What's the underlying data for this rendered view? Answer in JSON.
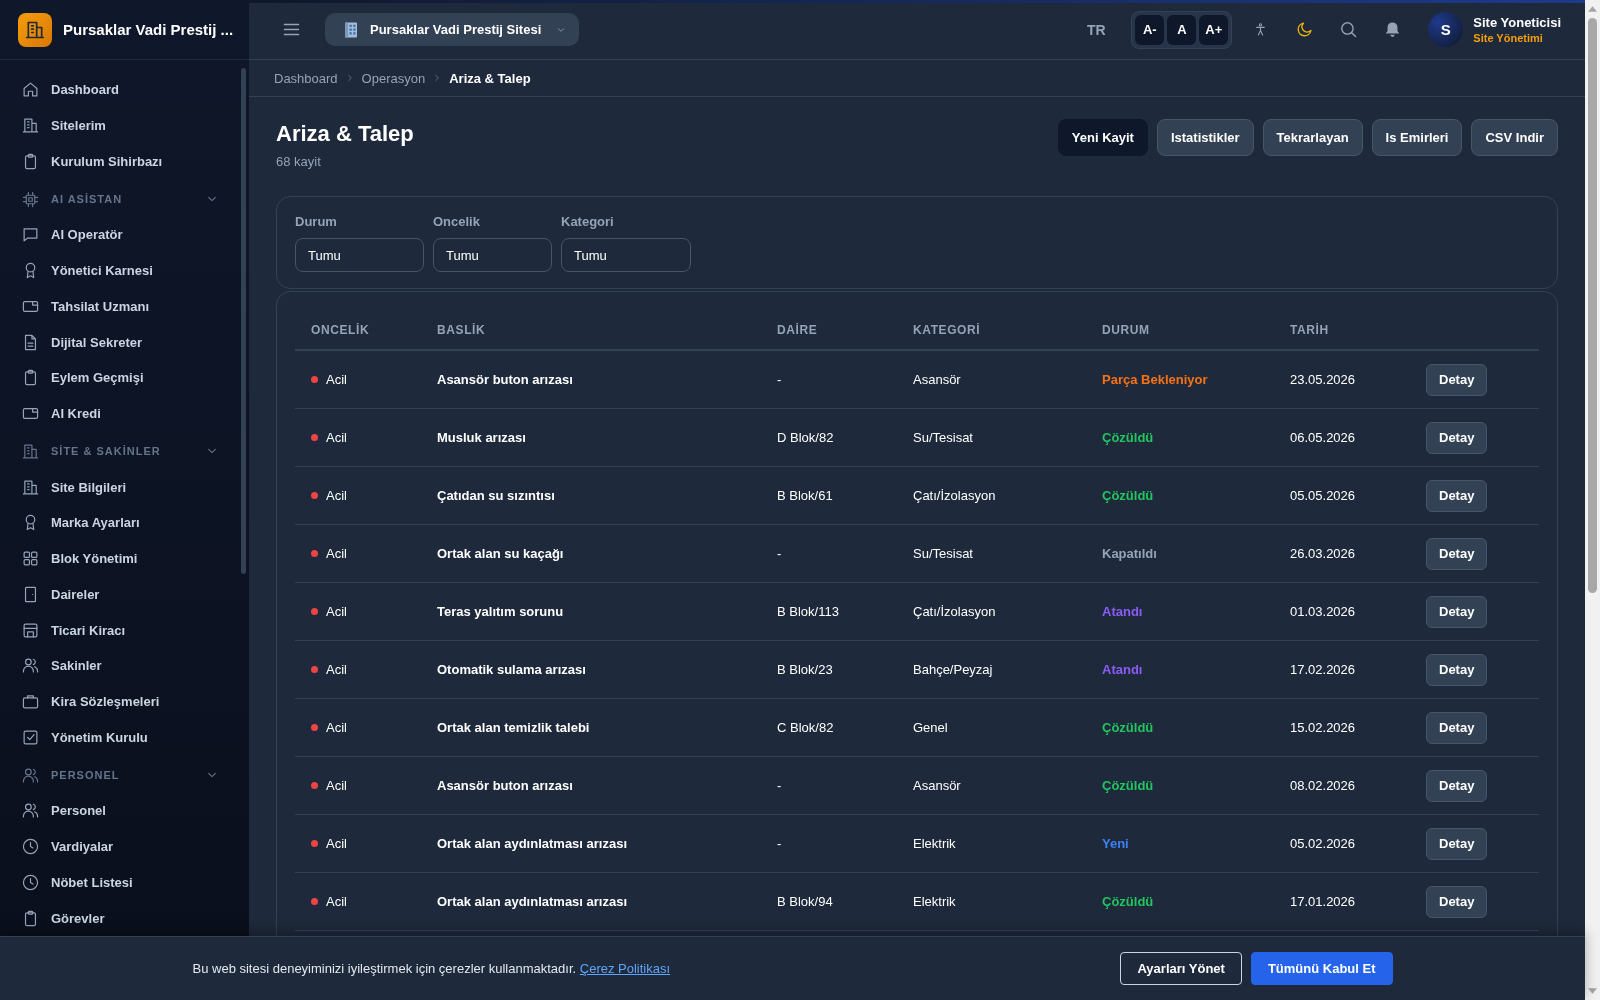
{
  "sidebar": {
    "brand": "Pursaklar Vadi Prestij ...",
    "items": [
      {
        "kind": "link",
        "label": "Dashboard",
        "selected": false
      },
      {
        "kind": "link",
        "label": "Sitelerim",
        "selected": false
      },
      {
        "kind": "link",
        "label": "Kurulum Sihirbazı",
        "selected": false
      },
      {
        "kind": "section",
        "label": "AI ASİSTAN",
        "expanded": true,
        "children": [
          {
            "label": "AI Operatör",
            "selected": false
          },
          {
            "label": "Yönetici Karnesi",
            "selected": false
          },
          {
            "label": "Tahsilat Uzmanı",
            "selected": false
          },
          {
            "label": "Dijital Sekreter",
            "selected": false
          },
          {
            "label": "Eylem Geçmişi",
            "selected": false
          },
          {
            "label": "AI Kredi",
            "selected": false
          }
        ]
      },
      {
        "kind": "section",
        "label": "SİTE & SAKİNLER",
        "expanded": true,
        "children": [
          {
            "label": "Site Bilgileri",
            "selected": false
          },
          {
            "label": "Marka Ayarları",
            "selected": false
          },
          {
            "label": "Blok Yönetimi",
            "selected": false
          },
          {
            "label": "Daireler",
            "selected": false
          },
          {
            "label": "Ticari Kiracı",
            "selected": false
          },
          {
            "label": "Sakinler",
            "selected": false
          },
          {
            "label": "Kira Sözleşmeleri",
            "selected": false
          },
          {
            "label": "Yönetim Kurulu",
            "selected": false
          }
        ]
      },
      {
        "kind": "section",
        "label": "PERSONEL",
        "expanded": true,
        "children": [
          {
            "label": "Personel",
            "selected": false
          },
          {
            "label": "Vardiyalar",
            "selected": false
          },
          {
            "label": "Nöbet Listesi",
            "selected": false
          },
          {
            "label": "Görevler",
            "selected": false
          }
        ]
      }
    ]
  },
  "header": {
    "site_selector": "Pursaklar Vadi Prestij Sitesi",
    "language": "TR",
    "font_size_buttons": [
      "A-",
      "A",
      "A+"
    ],
    "user": {
      "initial": "S",
      "name": "Site Yoneticisi",
      "role": "Site Yönetimi"
    }
  },
  "breadcrumb": [
    "Dashboard",
    "Operasyon",
    "Ariza & Talep"
  ],
  "page": {
    "title": "Ariza & Talep",
    "count": "68 kayit",
    "actions": [
      {
        "label": "Yeni Kayit",
        "kind": "primary"
      },
      {
        "label": "Istatistikler",
        "kind": "secondary"
      },
      {
        "label": "Tekrarlayan",
        "kind": "secondary"
      },
      {
        "label": "Is Emirleri",
        "kind": "secondary"
      },
      {
        "label": "CSV Indir",
        "kind": "secondary"
      }
    ]
  },
  "filters": [
    {
      "label": "Durum",
      "value": "Tumu"
    },
    {
      "label": "Oncelik",
      "value": "Tumu"
    },
    {
      "label": "Kategori",
      "value": "Tumu"
    }
  ],
  "table": {
    "columns": [
      "ONCELİK",
      "BASLİK",
      "DAİRE",
      "KATEGORİ",
      "DURUM",
      "TARİH"
    ],
    "rows": [
      {
        "priority": {
          "text": "Acil",
          "color": "#ef4444"
        },
        "title": "Asansör buton arızası",
        "unit": "-",
        "category": "Asansör",
        "status": {
          "text": "Parça Bekleniyor",
          "color": "#f97316"
        },
        "date": "23.05.2026",
        "action": "Detay"
      },
      {
        "priority": {
          "text": "Acil",
          "color": "#ef4444"
        },
        "title": "Musluk arızası",
        "unit": "D Blok/82",
        "category": "Su/Tesisat",
        "status": {
          "text": "Çözüldü",
          "color": "#22c55e"
        },
        "date": "06.05.2026",
        "action": "Detay"
      },
      {
        "priority": {
          "text": "Acil",
          "color": "#ef4444"
        },
        "title": "Çatıdan su sızıntısı",
        "unit": "B Blok/61",
        "category": "Çatı/İzolasyon",
        "status": {
          "text": "Çözüldü",
          "color": "#22c55e"
        },
        "date": "05.05.2026",
        "action": "Detay"
      },
      {
        "priority": {
          "text": "Acil",
          "color": "#ef4444"
        },
        "title": "Ortak alan su kaçağı",
        "unit": "-",
        "category": "Su/Tesisat",
        "status": {
          "text": "Kapatıldı",
          "color": "#94a3b8"
        },
        "date": "26.03.2026",
        "action": "Detay"
      },
      {
        "priority": {
          "text": "Acil",
          "color": "#ef4444"
        },
        "title": "Teras yalıtım sorunu",
        "unit": "B Blok/113",
        "category": "Çatı/İzolasyon",
        "status": {
          "text": "Atandı",
          "color": "#8b5cf6"
        },
        "date": "01.03.2026",
        "action": "Detay"
      },
      {
        "priority": {
          "text": "Acil",
          "color": "#ef4444"
        },
        "title": "Otomatik sulama arızası",
        "unit": "B Blok/23",
        "category": "Bahçe/Peyzaj",
        "status": {
          "text": "Atandı",
          "color": "#8b5cf6"
        },
        "date": "17.02.2026",
        "action": "Detay"
      },
      {
        "priority": {
          "text": "Acil",
          "color": "#ef4444"
        },
        "title": "Ortak alan temizlik talebi",
        "unit": "C Blok/82",
        "category": "Genel",
        "status": {
          "text": "Çözüldü",
          "color": "#22c55e"
        },
        "date": "15.02.2026",
        "action": "Detay"
      },
      {
        "priority": {
          "text": "Acil",
          "color": "#ef4444"
        },
        "title": "Asansör buton arızası",
        "unit": "-",
        "category": "Asansör",
        "status": {
          "text": "Çözüldü",
          "color": "#22c55e"
        },
        "date": "08.02.2026",
        "action": "Detay"
      },
      {
        "priority": {
          "text": "Acil",
          "color": "#ef4444"
        },
        "title": "Ortak alan aydınlatması arızası",
        "unit": "-",
        "category": "Elektrik",
        "status": {
          "text": "Yeni",
          "color": "#3b82f6"
        },
        "date": "05.02.2026",
        "action": "Detay"
      },
      {
        "priority": {
          "text": "Acil",
          "color": "#ef4444"
        },
        "title": "Ortak alan aydınlatması arızası",
        "unit": "B Blok/94",
        "category": "Elektrik",
        "status": {
          "text": "Çözüldü",
          "color": "#22c55e"
        },
        "date": "17.01.2026",
        "action": "Detay"
      }
    ]
  },
  "cookie_banner": {
    "text": "Bu web sitesi deneyiminizi iyileştirmek için çerezler kullanmaktadır.",
    "link": "Çerez Politikası",
    "buttons": [
      {
        "label": "Ayarları Yönet",
        "kind": "outline"
      },
      {
        "label": "Tümünü Kabul Et",
        "kind": "primary"
      }
    ]
  }
}
